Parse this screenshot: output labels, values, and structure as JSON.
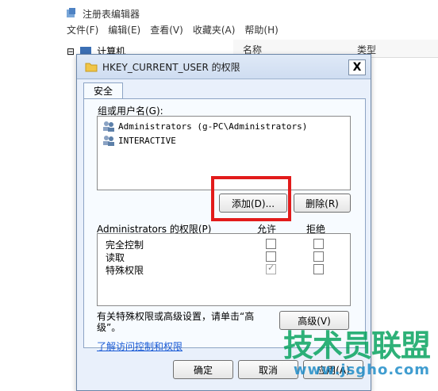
{
  "registry": {
    "title": "注册表编辑器",
    "menu": [
      "文件(F)",
      "编辑(E)",
      "查看(V)",
      "收藏夹(A)",
      "帮助(H)"
    ],
    "tree_root": "计算机",
    "columns": {
      "name": "名称",
      "type": "类型"
    }
  },
  "dialog": {
    "title": "HKEY_CURRENT_USER 的权限",
    "close": "X",
    "tab": "安全",
    "group_label": "组或用户名(G):",
    "users": [
      "Administrators (g-PC\\Administrators)",
      "INTERACTIVE"
    ],
    "add_button": "添加(D)...",
    "remove_button": "删除(R)",
    "perm_label": "Administrators 的权限(P)",
    "allow_label": "允许",
    "deny_label": "拒绝",
    "permissions": [
      {
        "name": "完全控制",
        "allow": false,
        "deny": false,
        "allow_disabled": false
      },
      {
        "name": "读取",
        "allow": false,
        "deny": false,
        "allow_disabled": false
      },
      {
        "name": "特殊权限",
        "allow": true,
        "deny": false,
        "allow_disabled": true
      }
    ],
    "special_hint": "有关特殊权限或高级设置，请单击“高级”。",
    "advanced_button": "高级(V)",
    "learn_link": "了解访问控制和权限",
    "ok_button": "确定",
    "cancel_button": "取消",
    "apply_button": "应用(A)"
  },
  "watermark": {
    "line1": "技术员联盟",
    "line2": "www.jsgho.com"
  },
  "colors": {
    "dialog_bg": "#e9f0fb",
    "highlight": "#e21b1b",
    "link": "#1a5bd6",
    "watermark_green": "#00a05a"
  }
}
